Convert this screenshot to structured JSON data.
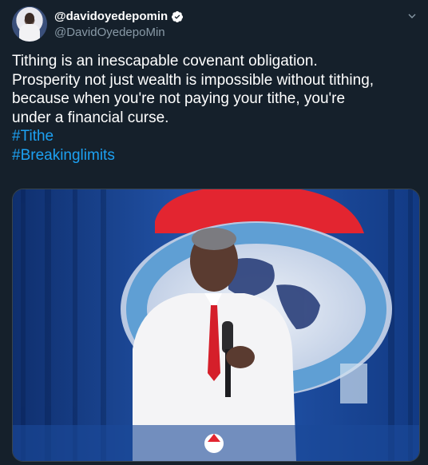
{
  "tweet": {
    "display_name": "@davidoyedepomin",
    "handle": "@DavidOyedepoMin",
    "text_lines": [
      "Tithing is an inescapable covenant obligation.",
      "Prosperity not just wealth is impossible without tithing,",
      "because when you're not paying your tithe, you're",
      "under a financial curse."
    ],
    "hashtags": [
      "#Tithe",
      "#Breakinglimits"
    ]
  },
  "icons": {
    "verified": "verified-badge-icon",
    "caret": "chevron-down-icon"
  },
  "colors": {
    "background": "#15202b",
    "link": "#1da1f2",
    "muted": "#8899a6"
  }
}
